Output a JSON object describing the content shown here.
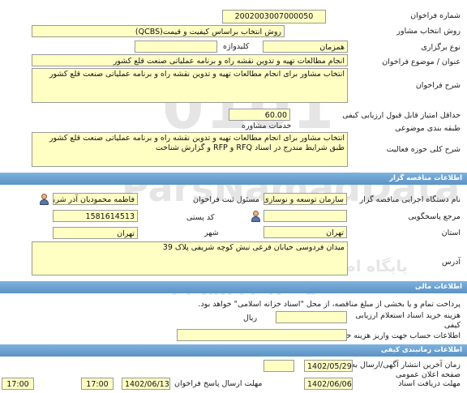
{
  "header": {
    "number_label": "شماره فراخوان",
    "number_value": "2002003007000050",
    "method_label": "روش انتخاب مشاور",
    "method_value": "روش انتخاب براساس کیفیت و قیمت(QCBS)",
    "type_label": "نوع برگزاری",
    "type_value": "همزمان",
    "keyword_label": "کلیدواژه",
    "keyword_value": "",
    "title_label": "عنوان / موضوع فراخوان",
    "title_value": "انجام مطالعات تهیه و تدوین نقشه راه و برنامه عملیاتی صنعت قلع کشور",
    "desc_label": "شرح فراخوان",
    "desc_value": "انتخاب مشاور برای انجام مطالعات تهیه و تدوین نقشه راه و برنامه عملیاتی صنعت قلع کشور",
    "min_score_label": "حداقل امتیاز قابل قبول ارزیابی کیفی",
    "min_score_value": "60.00",
    "category_label": "طبقه بندی موضوعی",
    "category_value": "خدمات مشاوره",
    "scope_label": "شرح کلی حوزه فعالیت",
    "scope_value": "انتخاب مشاور برای انجام مطالعات تهیه و تدوین نقشه راه و برنامه عملیاتی صنعت قلع کشور طبق شرایط مندرج در اسناد RFQ و RFP و گزارش شناخت"
  },
  "organizer": {
    "section_title": "اطلاعات مناقصه گزار",
    "org_label": "نام دستگاه اجرایی مناقصه گزار",
    "org_value": "سازمان توسعه و نوسازی م",
    "registrar_label": "مسئول ثبت فراخوان",
    "registrar_value": "فاطمه محمودیان آذر شربیانی",
    "reference_label": "مرجع پاسخگویی",
    "reference_value": "",
    "postal_label": "کد پستی",
    "postal_value": "1581614513",
    "province_label": "استان",
    "province_value": "تهران",
    "city_label": "شهر",
    "city_value": "تهران",
    "address_label": "آدرس",
    "address_value": "میدان فردوسی خیابان فرعی نبش کوچه شریفی پلاک 39"
  },
  "financial": {
    "section_title": "اطلاعات مالی",
    "note": "پرداخت تمام و یا بخشی از مبلغ مناقصه، از محل \"اسناد خزانه اسلامی\" خواهد بود.",
    "doc_fee_label": "هزینه خرید اسناد استعلام ارزیابی کیفی",
    "doc_fee_value": "",
    "currency": "ریال",
    "account_label": "اطلاعات حساب جهت واریز هزینه خرید",
    "account_value": ""
  },
  "schedule": {
    "section_title": "اطلاعات زمانبندی کیفی",
    "last_publish_label": "زمان آخرین انتشار آگهی/ارسال به صفحه اعلان عمومی",
    "last_publish_date": "1402/05/29",
    "last_publish_time": "",
    "deadline_label": "مهلت ارسال پاسخ فراخوان",
    "deadline_date": "1402/06/13",
    "deadline_time": "17:00",
    "receive_label": "مهلت دریافت اسناد",
    "receive_date": "1402/06/06",
    "receive_time": "17:00"
  },
  "watermark": {
    "line1": "0101",
    "line2": "ParsNamadData",
    "line3": "پایگاه اطلاع رسانی مناقصه ومزایده",
    "line4": "۰۲۱-۸۸۳۴۶۹۷۰-۵"
  },
  "colors": {
    "field_bg": "#ffffc4",
    "section_bg": "#5a93c6"
  }
}
